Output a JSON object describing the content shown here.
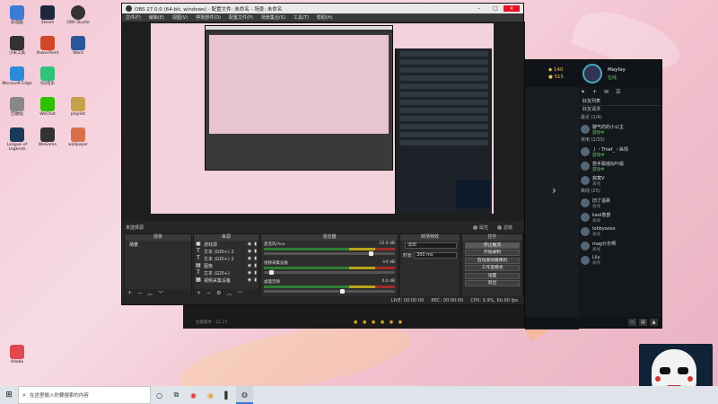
{
  "desktop": {
    "icons": [
      {
        "label": "此电脑",
        "color": "#3a7bd5"
      },
      {
        "label": "小米工具",
        "color": "#333"
      },
      {
        "label": "Microsoft Edge",
        "color": "#2a8bd8"
      },
      {
        "label": "回收站",
        "color": "#888"
      },
      {
        "label": "League of Legends",
        "color": "#1a3a5a"
      },
      {
        "label": "Steam",
        "color": "#1b2838"
      },
      {
        "label": "PowerPoint",
        "color": "#d24726"
      },
      {
        "label": "QQ音乐",
        "color": "#31c27c"
      },
      {
        "label": "WeChat",
        "color": "#2dc100"
      },
      {
        "label": "WeGame",
        "color": "#333"
      },
      {
        "label": "OBS Studio",
        "color": "#333"
      },
      {
        "label": "Word",
        "color": "#2b579a"
      },
      {
        "label": "Adobe",
        "color": "#e34850"
      },
      {
        "label": "playlist",
        "color": "#c8a04a"
      },
      {
        "label": "wallpaper",
        "color": "#d8704a"
      }
    ]
  },
  "obs": {
    "title": "OBS 27.0.0 (64-bit, windows) - 配置文件: 未命名 - 场景: 未命名",
    "menu": [
      "文件(F)",
      "编辑(E)",
      "视图(V)",
      "停靠部件(D)",
      "配置文件(P)",
      "场景集合(S)",
      "工具(T)",
      "帮助(H)"
    ],
    "mid": {
      "scene_label": "未选择源",
      "props": "属性",
      "filters": "滤镜"
    },
    "docks": {
      "scenes": {
        "header": "场景",
        "items": [
          "场景"
        ]
      },
      "sources": {
        "header": "来源",
        "items": [
          {
            "icon": "▣",
            "name": "游戏源"
          },
          {
            "icon": "T",
            "name": "文本 (GDI+) 2"
          },
          {
            "icon": "T",
            "name": "文本 (GDI+) 2"
          },
          {
            "icon": "▤",
            "name": "图像"
          },
          {
            "icon": "T",
            "name": "文本 (GDI+)"
          },
          {
            "icon": "▦",
            "name": "视频采集设备"
          }
        ]
      },
      "mixer": {
        "header": "混音器",
        "tracks": [
          {
            "name": "麦克风/Aux",
            "db": "-12.0 dB",
            "level": 0.82
          },
          {
            "name": "视频采集设备",
            "db": "-inf dB",
            "level": 0.06
          },
          {
            "name": "桌面音频",
            "db": "0.0 dB",
            "level": 0.6
          }
        ]
      },
      "transitions": {
        "header": "转场特效",
        "type": "淡出",
        "duration_label": "时长",
        "duration": "300 ms"
      },
      "controls": {
        "header": "控件",
        "buttons": [
          "停止推流",
          "开始录制",
          "启动虚拟摄像机",
          "工作室模式",
          "设置",
          "退出"
        ]
      }
    },
    "status": {
      "drops": "LIVE: 00:00:00",
      "rec": "REC: 00:00:00",
      "cpu": "CPU: 3.9%, 60.00 fps"
    }
  },
  "game": {
    "currency_1": "140",
    "currency_2": "515",
    "username": "Mayfay",
    "user_status": "在线",
    "tab": "好友列表",
    "subtab": "好友请求",
    "groups": [
      {
        "label": "最近 (1/4)",
        "friends": [
          {
            "name": "膝气的的小公主",
            "status": "游戏中",
            "online": true
          }
        ]
      },
      {
        "label": "常用 (2/35)",
        "friends": [
          {
            "name": "丿・Thief_・纵情",
            "status": "游戏中",
            "online": true
          },
          {
            "name": "若手飘摇似叶般",
            "status": "游戏中",
            "online": true
          },
          {
            "name": "寂寞V",
            "status": "离线",
            "online": false
          }
        ]
      },
      {
        "label": "离线 (25)",
        "friends": [
          {
            "name": "旧了温柔",
            "status": "离线",
            "online": false
          },
          {
            "name": "kaol蒸部",
            "status": "离线",
            "online": false
          },
          {
            "name": "lobbyaoso",
            "status": "离线",
            "online": false
          },
          {
            "name": "mag仆乐啊",
            "status": "离线",
            "online": false
          },
          {
            "name": "Lily",
            "status": "离线",
            "online": false
          }
        ]
      }
    ]
  },
  "strip": {
    "left_text": "功能服务 - 11.17"
  },
  "taskbar": {
    "search_placeholder": "在这里输入你要搜索的内容",
    "icons": [
      "cortana-icon",
      "task-view-icon",
      "netease-music-icon",
      "chrome-icon",
      "wallpaper-icon",
      "obs-icon"
    ]
  }
}
